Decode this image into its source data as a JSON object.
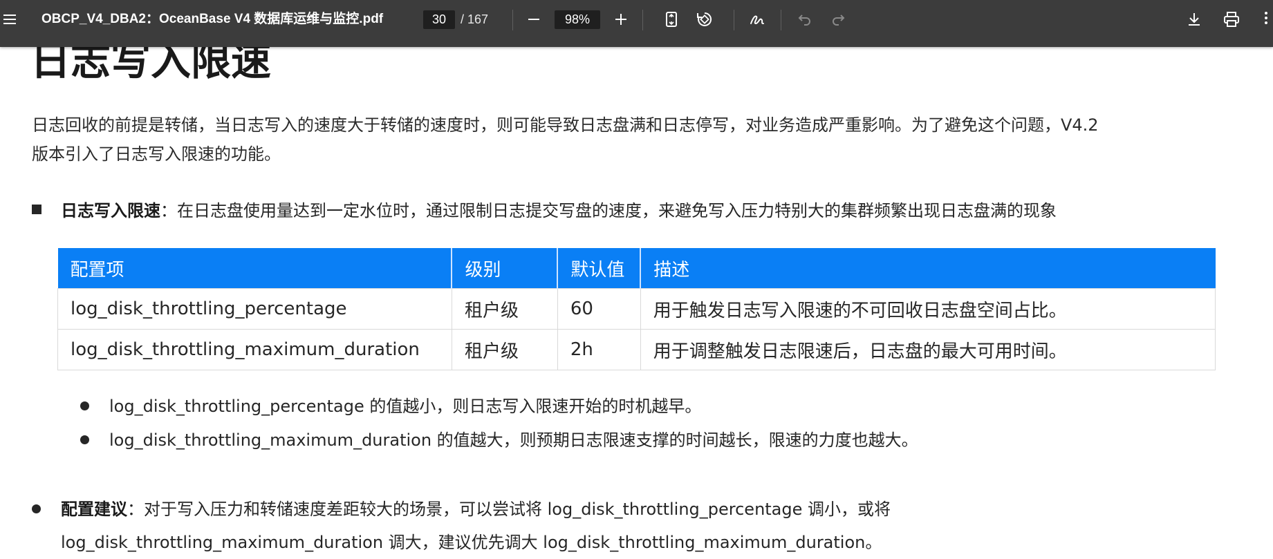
{
  "toolbar": {
    "title": "OBCP_V4_DBA2：OceanBase V4 数据库运维与监控.pdf",
    "page_current": "30",
    "page_total": "/ 167",
    "zoom": "98%",
    "icons": [
      "menu-icon",
      "zoom-out-icon",
      "zoom-in-icon",
      "fit-page-icon",
      "rotate-icon",
      "draw-icon",
      "undo-icon",
      "redo-icon",
      "download-icon",
      "print-icon",
      "more-icon"
    ]
  },
  "doc": {
    "heading": "日志写入限速",
    "intro_line1": "日志回收的前提是转储，当日志写入的速度大于转储的速度时，则可能导致日志盘满和日志停写，对业务造成严重影响。为了避免这个问题，V4.2",
    "intro_line2": "版本引入了日志写入限速的功能。",
    "bullet_label": "日志写入限速",
    "bullet_text": "：在日志盘使用量达到一定水位时，通过限制日志提交写盘的速度，来避免写入压力特别大的集群频繁出现日志盘满的现象",
    "table": {
      "headers": [
        "配置项",
        "级别",
        "默认值",
        "描述"
      ],
      "rows": [
        [
          "log_disk_throttling_percentage",
          "租户级",
          "60",
          "用于触发日志写入限速的不可回收日志盘空间占比。"
        ],
        [
          "log_disk_throttling_maximum_duration",
          "租户级",
          "2h",
          "用于调整触发日志限速后，日志盘的最大可用时间。"
        ]
      ]
    },
    "sub_bullets": [
      "log_disk_throttling_percentage 的值越小，则日志写入限速开始的时机越早。",
      "log_disk_throttling_maximum_duration 的值越大，则预期日志限速支撑的时间越长，限速的力度也越大。"
    ],
    "rec_label": "配置建议",
    "rec_line1": "：对于写入压力和转储速度差距较大的场景，可以尝试将 log_disk_throttling_percentage 调小，或将",
    "rec_line2": "log_disk_throttling_maximum_duration 调大，建议优先调大 log_disk_throttling_maximum_duration。"
  }
}
